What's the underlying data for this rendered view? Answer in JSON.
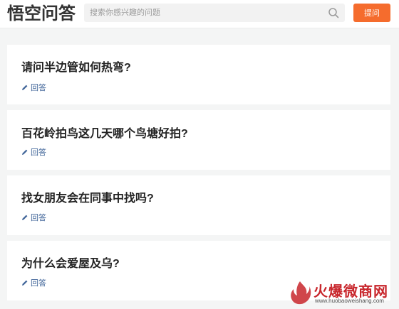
{
  "header": {
    "logo_text": "悟空问答",
    "search_placeholder": "搜索你感兴趣的问题",
    "ask_button_label": "提问"
  },
  "questions": [
    {
      "title": "请问半边管如何热弯?",
      "answer_label": "回答"
    },
    {
      "title": "百花岭拍鸟这几天哪个鸟塘好拍?",
      "answer_label": "回答"
    },
    {
      "title": "找女朋友会在同事中找吗?",
      "answer_label": "回答"
    },
    {
      "title": "为什么会爱屋及乌?",
      "answer_label": "回答"
    }
  ],
  "watermark": {
    "text": "火爆微商网",
    "url": "www.huobaoweishang.com"
  },
  "colors": {
    "accent": "#f56c2d",
    "link": "#406599",
    "background": "#f4f5f5"
  }
}
